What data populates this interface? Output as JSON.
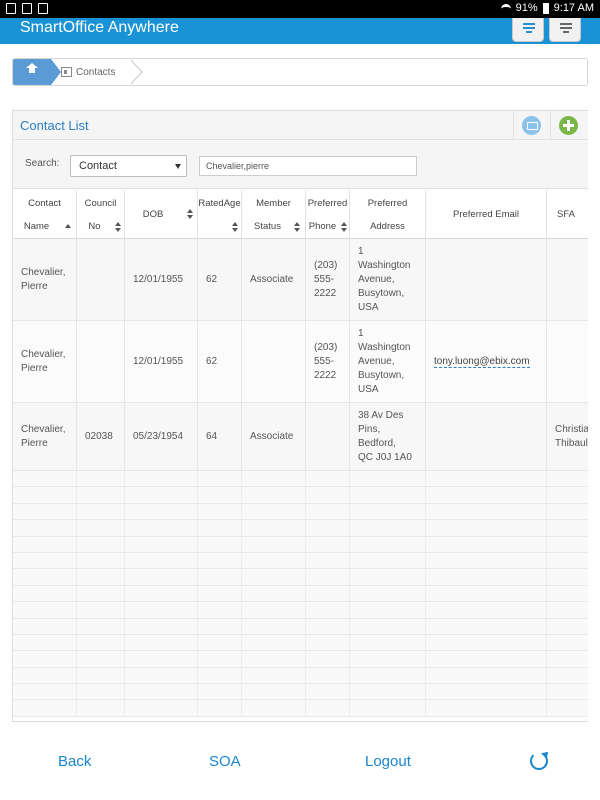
{
  "status_bar": {
    "battery": "91%",
    "time": "9:17 AM"
  },
  "app": {
    "title": "SmartOffice Anywhere"
  },
  "breadcrumb": {
    "current": "Contacts"
  },
  "panel": {
    "title": "Contact List"
  },
  "search": {
    "label": "Search:",
    "selected": "Contact",
    "value": "Chevalier,pierre"
  },
  "table": {
    "headers": {
      "contact_name": [
        "Contact",
        "Name"
      ],
      "council_no": [
        "Council",
        "No"
      ],
      "dob": "DOB",
      "rated_age": "RatedAge",
      "member_status": [
        "Member",
        "Status"
      ],
      "preferred_phone": [
        "Preferred",
        "Phone"
      ],
      "preferred_address": [
        "Preferred",
        "Address"
      ],
      "preferred_email": "Preferred Email",
      "sfa": "SFA"
    },
    "rows": [
      {
        "name": [
          "Chevalier,",
          "Pierre"
        ],
        "council": "",
        "dob": "12/01/1955",
        "age": "62",
        "status": "Associate",
        "phone": [
          "(203)",
          "555-",
          "2222"
        ],
        "address": [
          "1",
          "Washington",
          "Avenue,",
          "Busytown,",
          "USA"
        ],
        "email": "",
        "sfa": ""
      },
      {
        "name": [
          "Chevalier,",
          "Pierre"
        ],
        "council": "",
        "dob": "12/01/1955",
        "age": "62",
        "status": "",
        "phone": [
          "(203)",
          "555-",
          "2222"
        ],
        "address": [
          "1",
          "Washington",
          "Avenue,",
          "Busytown,",
          "USA"
        ],
        "email": "tony.luong@ebix.com",
        "sfa": ""
      },
      {
        "name": [
          "Chevalier,",
          "Pierre"
        ],
        "council": "02038",
        "dob": "05/23/1954",
        "age": "64",
        "status": "Associate",
        "phone": [
          "",
          "",
          ""
        ],
        "address": [
          "38 Av Des",
          "Pins,",
          "Bedford,",
          "QC J0J 1A0",
          ""
        ],
        "email": "",
        "sfa": [
          "Christian",
          "Thibault"
        ]
      }
    ]
  },
  "bottom_nav": {
    "back": "Back",
    "soa": "SOA",
    "logout": "Logout"
  },
  "colors": {
    "header": "#1a93d6",
    "link": "#1a86d0",
    "title": "#2c7fc2"
  }
}
